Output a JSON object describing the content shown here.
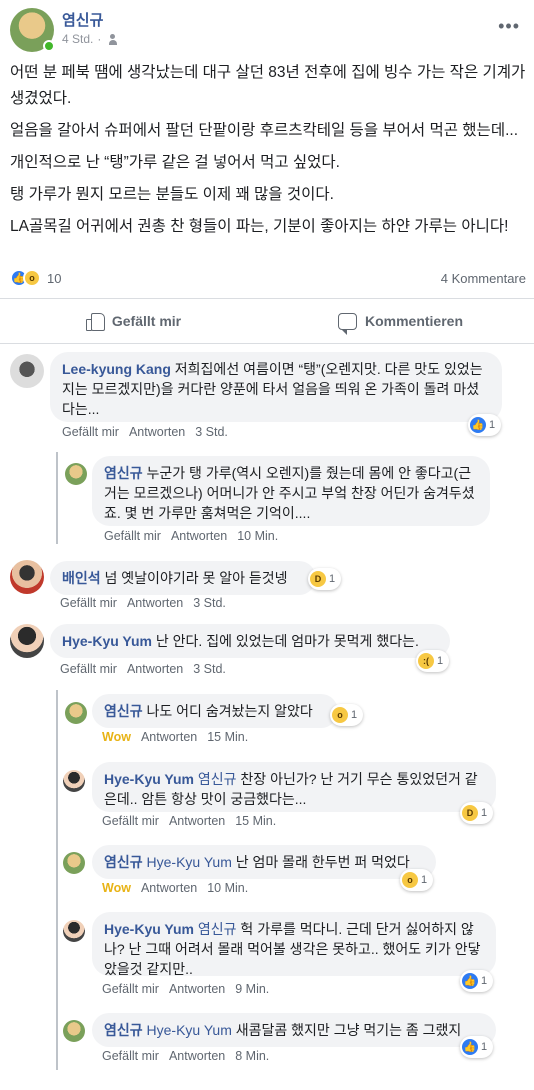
{
  "post": {
    "author": "염신규",
    "time": "4 Std.",
    "paragraphs": [
      "어떤 분 페북 땜에 생각났는데 대구 살던 83년 전후에 집에 빙수 가는 작은 기계가 생겼었다.",
      "얼음을 갈아서 슈퍼에서 팔던 단팥이랑 후르츠칵테일 등을 부어서 먹곤 했는데...",
      "개인적으로 난 “탱”가루 같은 걸 넣어서 먹고 싶었다.",
      "탱 가루가 뭔지 모르는 분들도 이제 꽤 많을 것이다.",
      "LA골목길 어귀에서 권총 찬 형들이 파는, 기분이 좋아지는 하얀 가루는 아니다!"
    ],
    "reaction_count": "10",
    "comments_count": "4 Kommentare"
  },
  "actions": {
    "like": "Gefällt mir",
    "comment": "Kommentieren"
  },
  "labels": {
    "like": "Gefällt mir",
    "reply": "Antworten",
    "wow": "Wow"
  },
  "comments": [
    {
      "name": "Lee-kyung Kang",
      "text": "저희집에선 여름이면 “탱”(오렌지맛. 다른 맛도 있었는지는 모르겠지만)을 커다란 양푼에 타서 얼음을 띄워 온 가족이 돌려 마셨다는...",
      "time": "3 Std.",
      "reaction": "1"
    },
    {
      "name": "염신규",
      "text": "누군가 탱 가루(역시 오렌지)를 줬는데 몸에 안 좋다고(근거는 모르겠으나) 어머니가 안 주시고 부엌 찬장 어딘가 숨겨두셨죠. 몇 번 가루만 훔쳐먹은 기억이....",
      "time": "10 Min."
    },
    {
      "name": "배인석",
      "text": "넘 옛날이야기라 못 알아 듣것넹",
      "time": "3 Std.",
      "reaction": "1"
    },
    {
      "name": "Hye-Kyu Yum",
      "text": "난 안다. 집에 있었는데 엄마가 못먹게 했다는.",
      "time": "3 Std.",
      "reaction": "1"
    },
    {
      "name": "염신규",
      "text": "나도 어디 숨겨놨는지 알았다",
      "time": "15 Min.",
      "reaction": "1"
    },
    {
      "name": "Hye-Kyu Yum",
      "mention": "염신규",
      "text": "찬장 아닌가? 난 거기 무슨 통있었던거 같은데.. 암튼 항상 맛이 궁금했다는...",
      "time": "15 Min.",
      "reaction": "1"
    },
    {
      "name": "염신규",
      "mention": "Hye-Kyu Yum",
      "text": "난 엄마 몰래 한두번 퍼 먹었다",
      "time": "10 Min.",
      "reaction": "1"
    },
    {
      "name": "Hye-Kyu Yum",
      "mention": "염신규",
      "text": "헉 가루를 먹다니. 근데 단거 싫어하지 않나? 난 그때 어려서 몰래 먹어볼 생각은 못하고.. 했어도 키가 안닿았을것 같지만..",
      "time": "9 Min.",
      "reaction": "1"
    },
    {
      "name": "염신규",
      "mention": "Hye-Kyu Yum",
      "text": "새콤달콤 했지만 그냥 먹기는 좀 그랬지",
      "time": "8 Min.",
      "reaction": "1"
    }
  ]
}
